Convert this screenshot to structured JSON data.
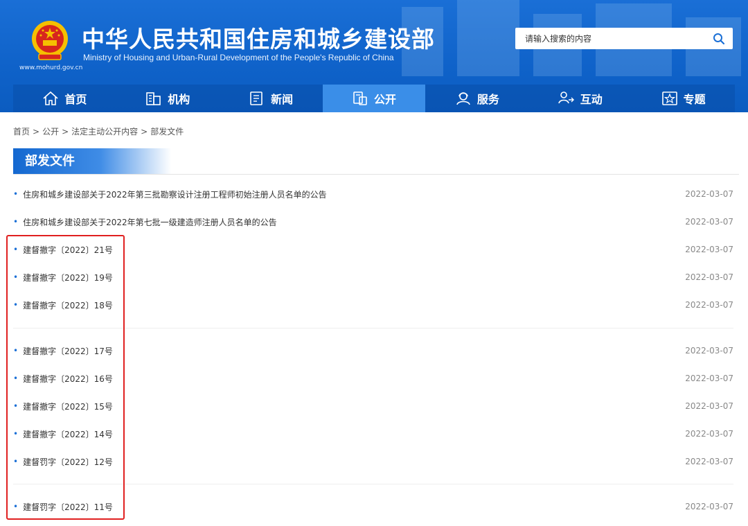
{
  "header": {
    "title": "中华人民共和国住房和城乡建设部",
    "subtitle": "Ministry of Housing and Urban-Rural Development of the People's Republic of China",
    "url": "www.mohurd.gov.cn",
    "emblem_icon": "national-emblem-icon",
    "search_placeholder": "请输入搜索的内容",
    "search_icon": "search-icon"
  },
  "nav": {
    "items": [
      {
        "label": "首页",
        "icon": "home-icon"
      },
      {
        "label": "机构",
        "icon": "building-icon"
      },
      {
        "label": "新闻",
        "icon": "news-icon"
      },
      {
        "label": "公开",
        "icon": "disclosure-icon",
        "active": true
      },
      {
        "label": "服务",
        "icon": "service-icon"
      },
      {
        "label": "互动",
        "icon": "interaction-icon"
      },
      {
        "label": "专题",
        "icon": "star-topic-icon"
      }
    ]
  },
  "breadcrumb": [
    "首页",
    "公开",
    "法定主动公开内容",
    "部发文件"
  ],
  "breadcrumb_sep": ">",
  "section": {
    "title": "部发文件"
  },
  "documents": [
    {
      "title": "住房和城乡建设部关于2022年第三批勘察设计注册工程师初始注册人员名单的公告",
      "date": "2022-03-07"
    },
    {
      "title": "住房和城乡建设部关于2022年第七批一级建造师注册人员名单的公告",
      "date": "2022-03-07"
    },
    {
      "title": "建督撤字〔2022〕21号",
      "date": "2022-03-07"
    },
    {
      "title": "建督撤字〔2022〕19号",
      "date": "2022-03-07"
    },
    {
      "title": "建督撤字〔2022〕18号",
      "date": "2022-03-07"
    },
    {
      "title": "建督撤字〔2022〕17号",
      "date": "2022-03-07"
    },
    {
      "title": "建督撤字〔2022〕16号",
      "date": "2022-03-07"
    },
    {
      "title": "建督撤字〔2022〕15号",
      "date": "2022-03-07"
    },
    {
      "title": "建督撤字〔2022〕14号",
      "date": "2022-03-07"
    },
    {
      "title": "建督罚字〔2022〕12号",
      "date": "2022-03-07"
    },
    {
      "title": "建督罚字〔2022〕11号",
      "date": "2022-03-07"
    }
  ],
  "colors": {
    "header_blue": "#1a6fd6",
    "nav_active": "#3a8ee8",
    "highlight_red": "#e02020",
    "bullet_blue": "#1a6fd6"
  }
}
